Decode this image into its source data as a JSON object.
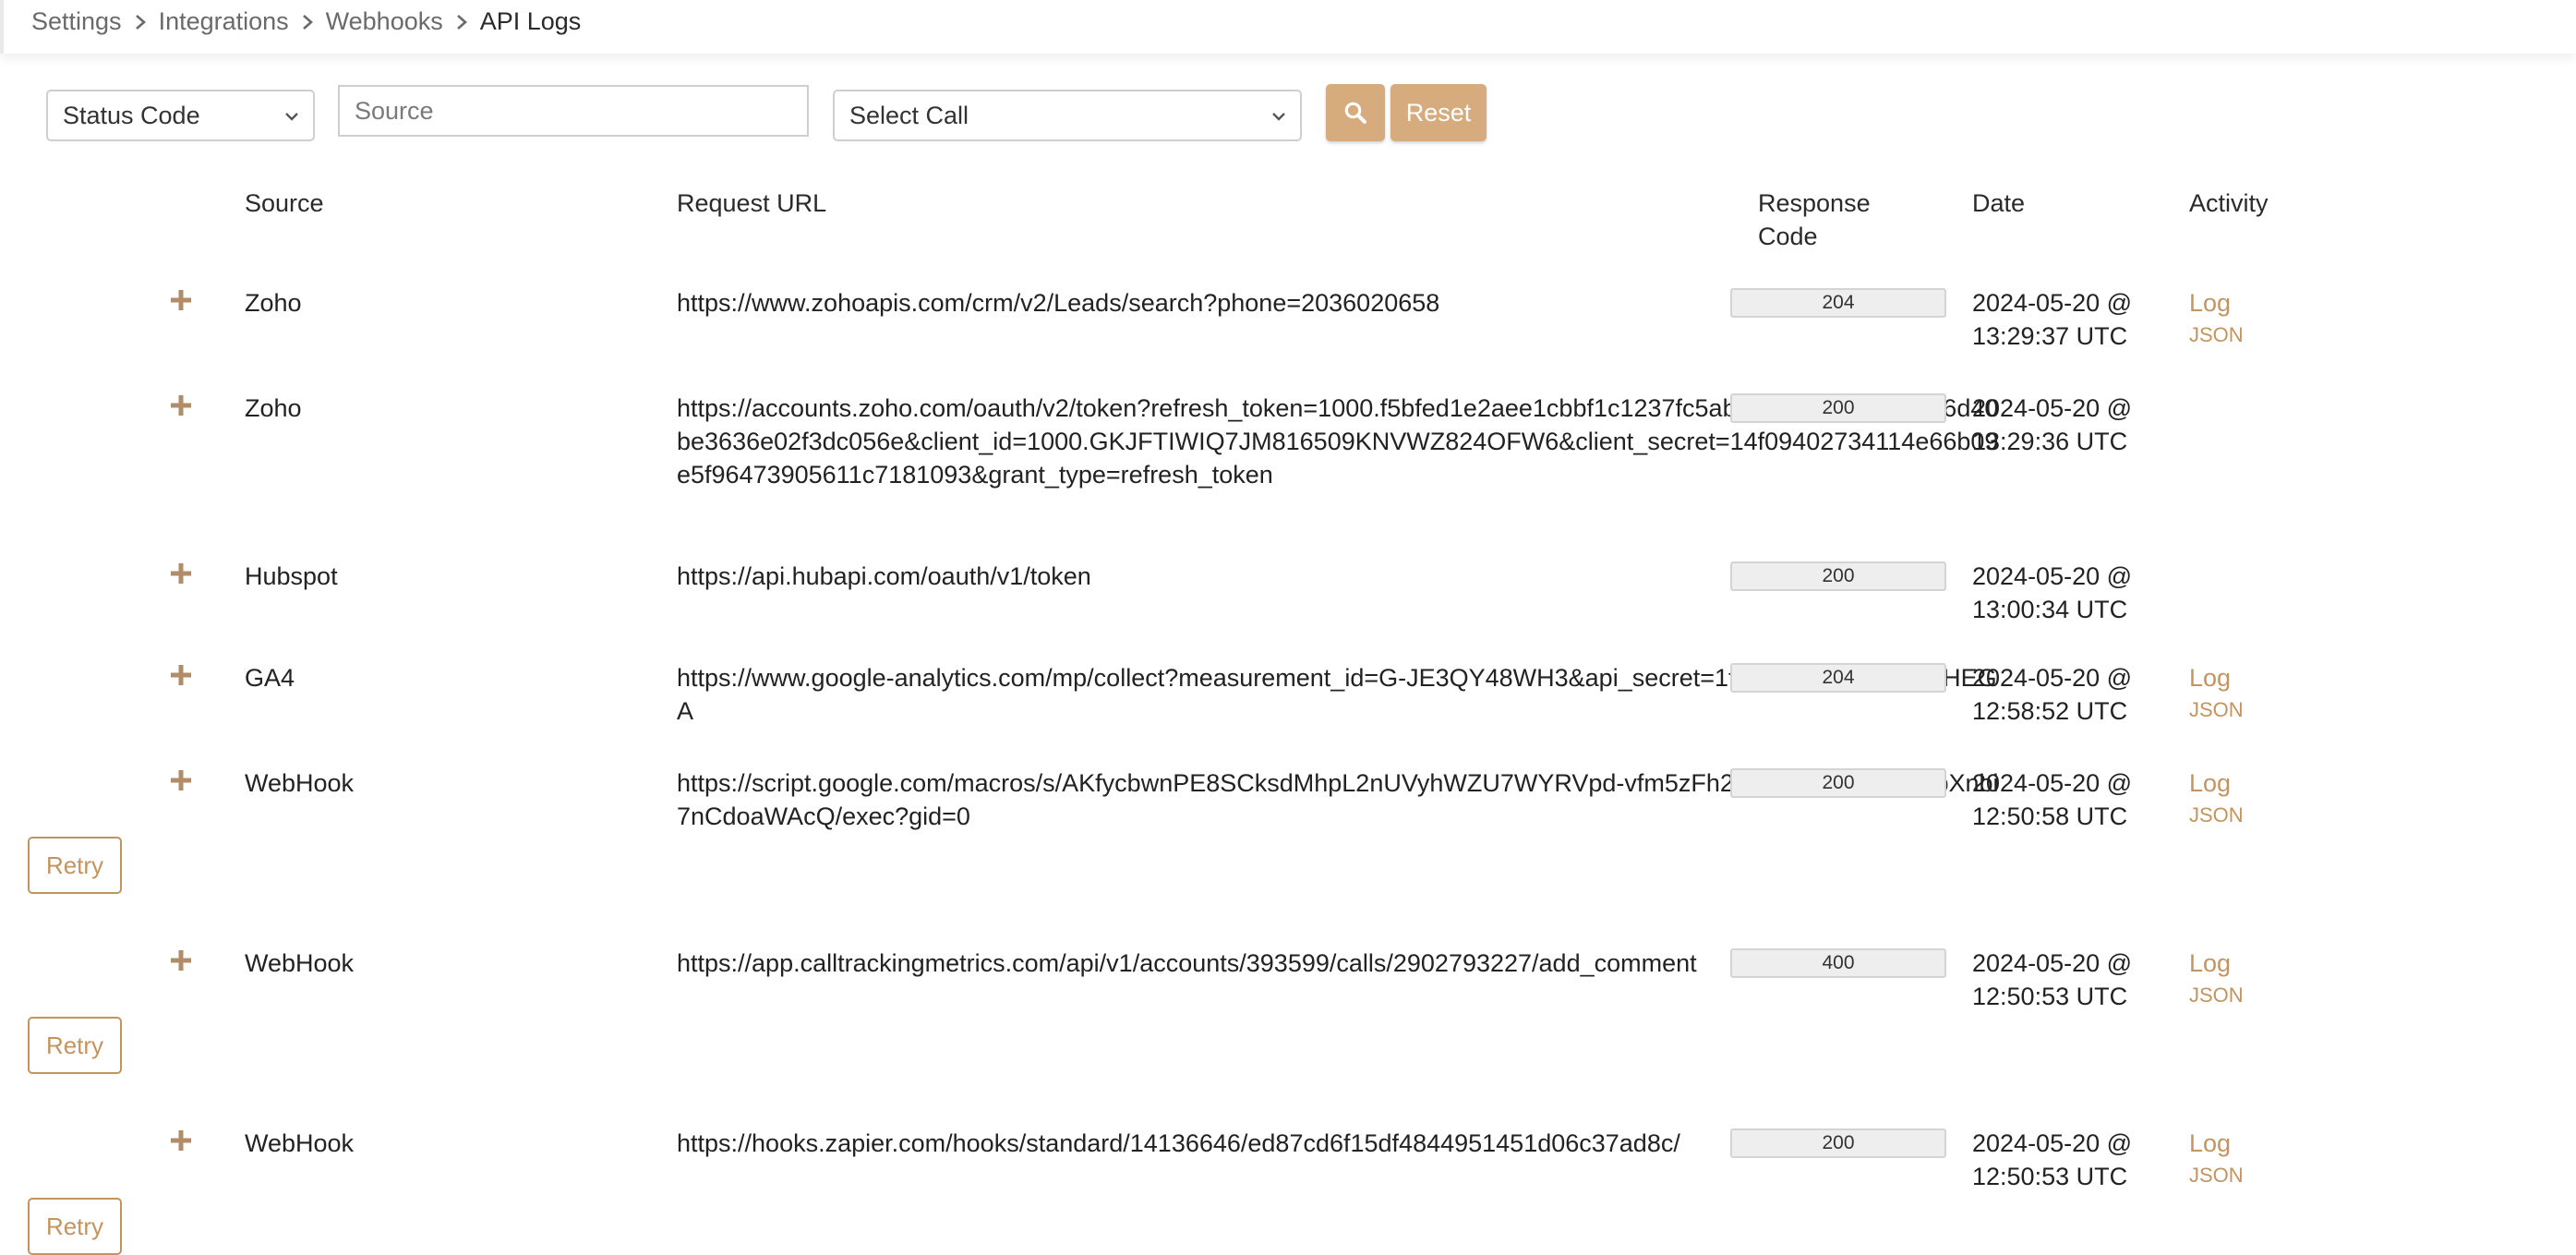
{
  "breadcrumb": [
    "Settings",
    "Integrations",
    "Webhooks",
    "API Logs"
  ],
  "filters": {
    "status_code": "Status Code",
    "source_placeholder": "Source",
    "select_call": "Select Call",
    "reset_label": "Reset"
  },
  "table": {
    "headers": {
      "source": "Source",
      "request_url": "Request URL",
      "response_code_line1": "Response",
      "response_code_line2": "Code",
      "date": "Date",
      "activity": "Activity"
    },
    "rows": [
      {
        "source": "Zoho",
        "url": "https://www.zohoapis.com/crm/v2/Leads/search?phone=2036020658",
        "code": "204",
        "date1": "2024-05-20 @",
        "date2": "13:29:37 UTC",
        "log": "Log",
        "json": "JSON"
      },
      {
        "source": "Zoho",
        "url": "https://accounts.zoho.com/oauth/v2/token?refresh_token=1000.f5bfed1e2aee1cbbf1c1237fc5abfacd.577a794b41b6d40be3636e02f3dc056e&client_id=1000.GKJFTIWIQ7JM816509KNVWZ824OFW6&client_secret=14f09402734114e66b09e5f96473905611c7181093&grant_type=refresh_token",
        "code": "200",
        "date1": "2024-05-20 @",
        "date2": "13:29:36 UTC"
      },
      {
        "source": "Hubspot",
        "url": "https://api.hubapi.com/oauth/v1/token",
        "code": "200",
        "date1": "2024-05-20 @",
        "date2": "13:00:34 UTC"
      },
      {
        "source": "GA4",
        "url": "https://www.google-analytics.com/mp/collect?measurement_id=G-JE3QY48WH3&api_secret=1tijzY5tRV2h2wfcSXHEGA",
        "code": "204",
        "date1": "2024-05-20 @",
        "date2": "12:58:52 UTC",
        "log": "Log",
        "json": "JSON"
      },
      {
        "source": "WebHook",
        "url": "https://script.google.com/macros/s/AKfycbwnPE8SCksdMhpL2nUVyhWZU7WYRVpd-vfm5zFh2mKZCh3pV-jcSRsbXnbi7nCdoaWAcQ/exec?gid=0",
        "code": "200",
        "date1": "2024-05-20 @",
        "date2": "12:50:58 UTC",
        "log": "Log",
        "json": "JSON",
        "retry": "Retry"
      },
      {
        "source": "WebHook",
        "url": "https://app.calltrackingmetrics.com/api/v1/accounts/393599/calls/2902793227/add_comment",
        "code": "400",
        "date1": "2024-05-20 @",
        "date2": "12:50:53 UTC",
        "log": "Log",
        "json": "JSON",
        "retry": "Retry"
      },
      {
        "source": "WebHook",
        "url": "https://hooks.zapier.com/hooks/standard/14136646/ed87cd6f15df4844951451d06c37ad8c/",
        "code": "200",
        "date1": "2024-05-20 @",
        "date2": "12:50:53 UTC",
        "log": "Log",
        "json": "JSON",
        "retry": "Retry"
      }
    ]
  },
  "colors": {
    "accent": "#d6ab7d",
    "link": "#c4945f"
  },
  "icons": {
    "separator": "chevron-right-icon",
    "search": "search-icon",
    "expand": "plus-icon",
    "dropdown": "chevron-down-icon"
  }
}
